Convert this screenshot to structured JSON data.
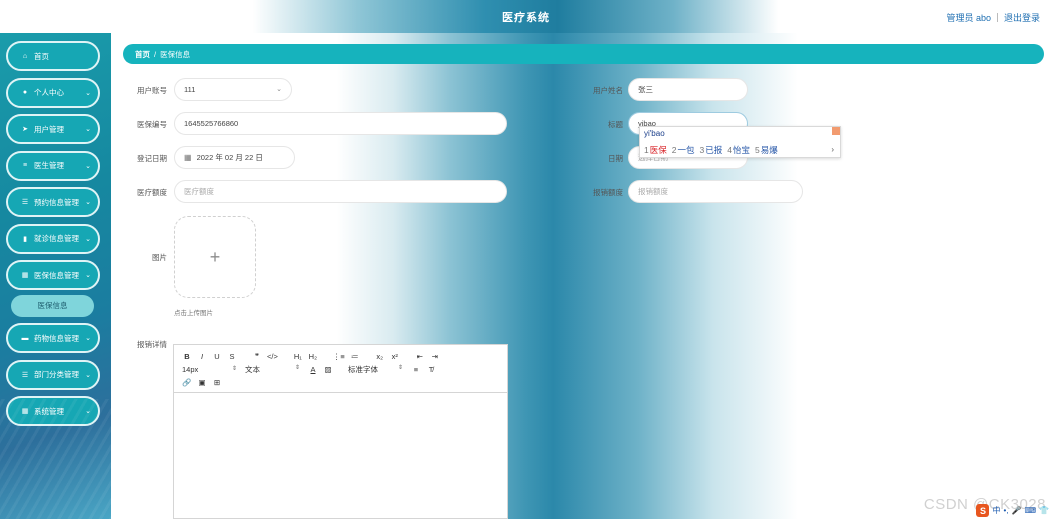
{
  "header": {
    "app_title": "医疗系统",
    "admin_label": "管理员 abo",
    "logout_label": "退出登录"
  },
  "sidebar": {
    "items": [
      {
        "label": "首页",
        "icon": "home-icon",
        "glyph": "⌂",
        "has_arrow": false
      },
      {
        "label": "个人中心",
        "icon": "user-icon",
        "glyph": "●",
        "has_arrow": true
      },
      {
        "label": "用户管理",
        "icon": "send-icon",
        "glyph": "➤",
        "has_arrow": true
      },
      {
        "label": "医生管理",
        "icon": "sliders-icon",
        "glyph": "≡",
        "has_arrow": true
      },
      {
        "label": "预约信息管理",
        "icon": "list-icon",
        "glyph": "☰",
        "has_arrow": true
      },
      {
        "label": "就诊信息管理",
        "icon": "clipboard-icon",
        "glyph": "▮",
        "has_arrow": true
      },
      {
        "label": "医保信息管理",
        "icon": "grid-icon",
        "glyph": "▦",
        "has_arrow": true,
        "expanded": true
      },
      {
        "label": "药物信息管理",
        "icon": "card-icon",
        "glyph": "▬",
        "has_arrow": true
      },
      {
        "label": "部门分类管理",
        "icon": "menu-icon",
        "glyph": "☰",
        "has_arrow": true
      },
      {
        "label": "系统管理",
        "icon": "grid-icon",
        "glyph": "▦",
        "has_arrow": true
      }
    ],
    "active_sub_item": "医保信息"
  },
  "breadcrumb": {
    "home": "首页",
    "separator": "/",
    "current": "医保信息"
  },
  "form": {
    "user_account": {
      "label": "用户账号",
      "value": "111"
    },
    "user_name": {
      "label": "用户姓名",
      "value": "张三"
    },
    "insurance_no": {
      "label": "医保编号",
      "value": "1645525766860"
    },
    "title": {
      "label": "标题",
      "value": "yibao"
    },
    "register_date": {
      "label": "登记日期",
      "value": "2022 年 02 月 22 日"
    },
    "date": {
      "label": "日期",
      "placeholder": "选择日期"
    },
    "medical_amount": {
      "label": "医疗额度",
      "placeholder": "医疗额度"
    },
    "reimburse_amount": {
      "label": "报销额度",
      "placeholder": "报销额度"
    },
    "image": {
      "label": "图片",
      "upload_tip": "点击上传图片"
    },
    "details": {
      "label": "报销详情"
    }
  },
  "editor_toolbar": {
    "row1": [
      "B",
      "I",
      "U",
      "S",
      "❞",
      "</>",
      "H₁",
      "H₂",
      "⋮≡",
      "≔",
      "x₂",
      "x²",
      "⇤",
      "⇥"
    ],
    "font_size": "14px",
    "text_style": "文本",
    "font_family": "标准字体",
    "color_a": "A",
    "color_bg": "▨",
    "align": "≡",
    "clear_format": "T̸",
    "row3": [
      "🔗",
      "▣",
      "⊞"
    ]
  },
  "ime": {
    "composition": "yi'bao",
    "candidates": [
      {
        "n": "1",
        "text": "医保"
      },
      {
        "n": "2",
        "text": "一包"
      },
      {
        "n": "3",
        "text": "已报"
      },
      {
        "n": "4",
        "text": "怡宝"
      },
      {
        "n": "5",
        "text": "易爆"
      }
    ],
    "next": "›"
  },
  "watermark": "CSDN @CK3028",
  "tray": {
    "s": "S",
    "items": [
      "中",
      "•,",
      "🎤",
      "⌨",
      "👕"
    ]
  },
  "colors": {
    "sidebar_item": "#16a7b4",
    "breadcrumb": "#16b3bd",
    "submenu_active": "#7fd5db",
    "ime_selected": "#d9262b"
  }
}
